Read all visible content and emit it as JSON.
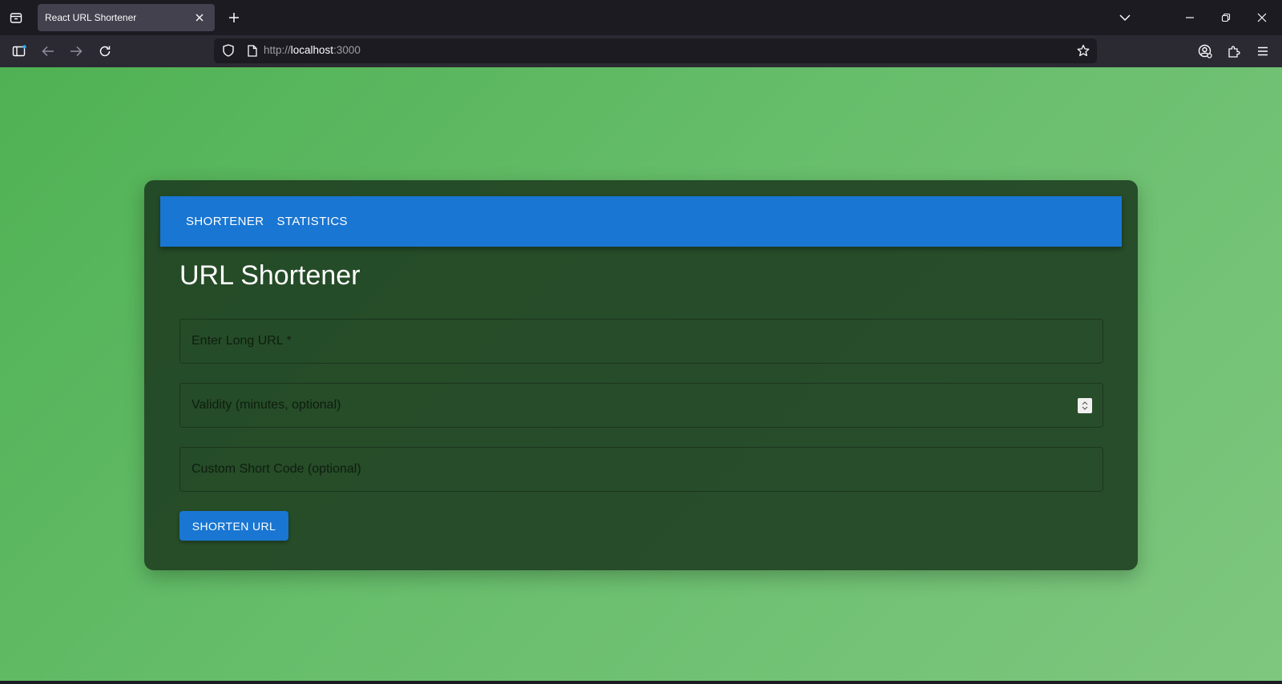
{
  "browser": {
    "tab_title": "React URL Shortener",
    "url_host": "localhost",
    "url_prefix": "http://",
    "url_port": ":3000"
  },
  "app": {
    "nav": [
      {
        "label": "SHORTENER"
      },
      {
        "label": "STATISTICS"
      }
    ],
    "title": "URL Shortener",
    "fields": {
      "long_url": {
        "placeholder": "Enter Long URL *",
        "value": ""
      },
      "validity": {
        "placeholder": "Validity (minutes, optional)",
        "value": ""
      },
      "short_code": {
        "placeholder": "Custom Short Code (optional)",
        "value": ""
      }
    },
    "submit_label": "SHORTEN URL"
  },
  "colors": {
    "accent": "#1976d2",
    "card": "#2d4b2e",
    "background_start": "#4fb153",
    "background_end": "#7ec77f"
  }
}
